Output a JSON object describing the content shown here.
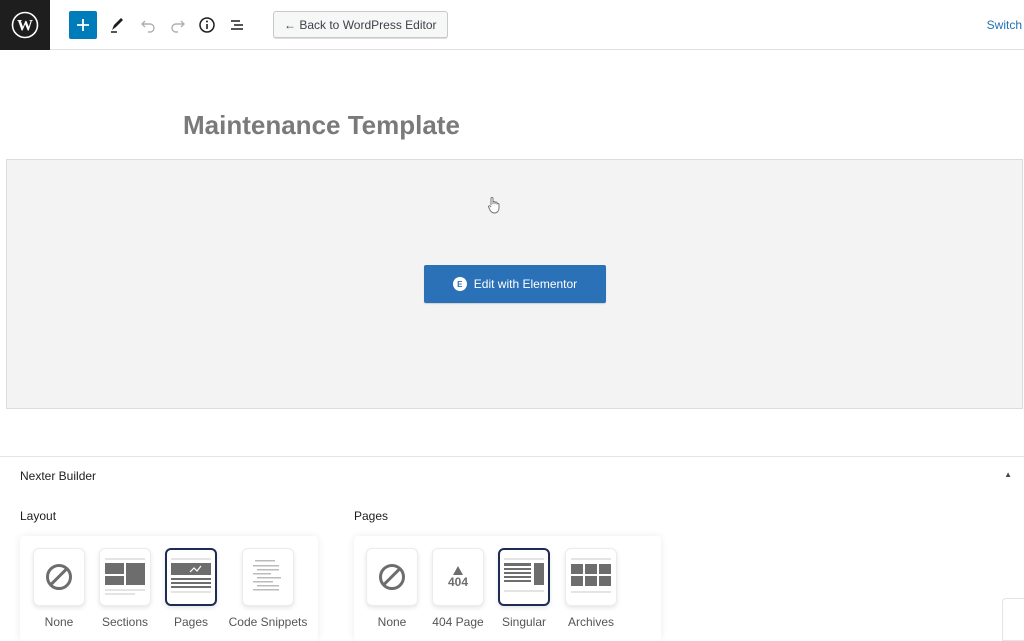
{
  "toolbar": {
    "back_label": "← Back to WordPress Editor",
    "switch_label": "Switch"
  },
  "page": {
    "title": "Maintenance Template"
  },
  "elementor": {
    "button_label": "Edit with Elementor",
    "badge_glyph": "E"
  },
  "nexter": {
    "title": "Nexter Builder",
    "layout": {
      "label": "Layout",
      "options": [
        "None",
        "Sections",
        "Pages",
        "Code Snippets"
      ],
      "selected": "Pages"
    },
    "pages": {
      "label": "Pages",
      "options": [
        "None",
        "404 Page",
        "Singular",
        "Archives"
      ],
      "selected": "Singular",
      "icon_404_text": "404"
    }
  },
  "colors": {
    "accent": "#007cba",
    "elementor_button": "#2a71b8",
    "selected_border": "#1e2c55"
  }
}
